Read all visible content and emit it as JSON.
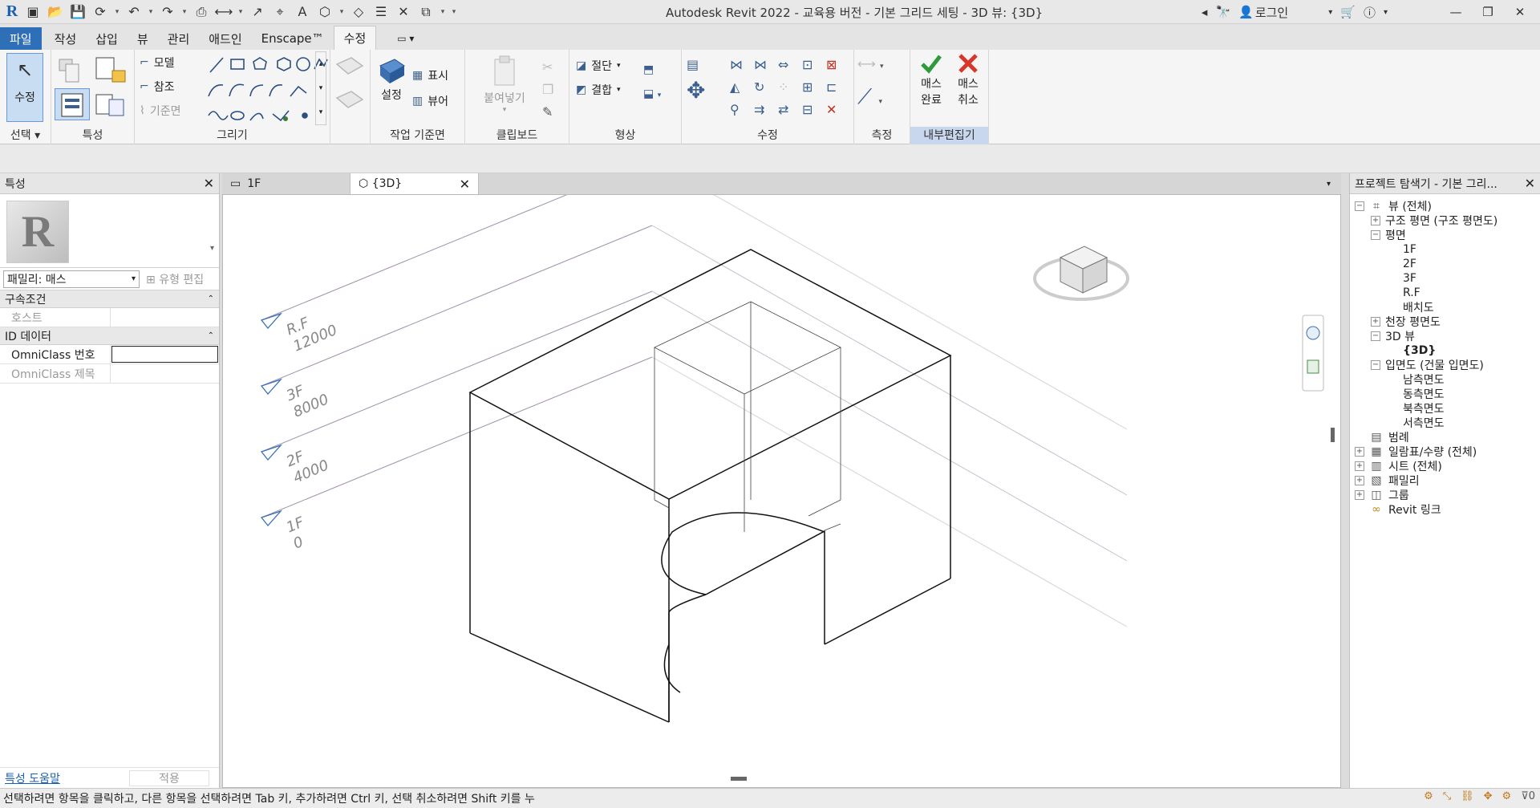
{
  "title_bar": {
    "window_title": "Autodesk Revit 2022 - 교육용 버전 - 기본 그리드 세팅 - 3D 뷰: {3D}",
    "login_label": "로그인"
  },
  "ribbon_tabs": [
    "파일",
    "작성",
    "삽입",
    "뷰",
    "관리",
    "애드인",
    "Enscape™",
    "수정"
  ],
  "ribbon": {
    "select": {
      "modify_label": "수정",
      "panel_label": "선택"
    },
    "properties": {
      "panel_label": "특성"
    },
    "draw": {
      "model_label": "모델",
      "ref_label": "참조",
      "plane_label": "기준면",
      "panel_label": "그리기"
    },
    "workplane": {
      "set_label": "설정",
      "show_label": "표시",
      "viewer_label": "뷰어",
      "panel_label": "작업 기준면"
    },
    "clipboard": {
      "paste_label": "붙여넣기",
      "panel_label": "클립보드"
    },
    "geometry": {
      "cut_label": "절단",
      "join_label": "결합",
      "panel_label": "형상"
    },
    "modify": {
      "panel_label": "수정"
    },
    "measure": {
      "panel_label": "측정"
    },
    "inplace": {
      "finish_label": "매스\n완료",
      "finish_l1": "매스",
      "finish_l2": "완료",
      "cancel_l1": "매스",
      "cancel_l2": "취소",
      "panel_label": "내부편집기"
    }
  },
  "properties_palette": {
    "title": "특성",
    "family_label": "패밀리: 매스",
    "edit_type_label": "유형 편집",
    "groups": [
      {
        "name": "구속조건",
        "rows": [
          {
            "key": "호스트",
            "value": ""
          }
        ]
      },
      {
        "name": "ID 데이터",
        "rows": [
          {
            "key": "OmniClass 번호",
            "value": ""
          },
          {
            "key": "OmniClass 제목",
            "value": ""
          }
        ]
      }
    ],
    "help_link": "특성 도움말",
    "apply_label": "적용"
  },
  "view_tabs": [
    {
      "label": "1F",
      "active": false
    },
    {
      "label": "{3D}",
      "active": true
    }
  ],
  "levels": [
    {
      "name": "R.F",
      "elevation": "12000"
    },
    {
      "name": "3F",
      "elevation": "8000"
    },
    {
      "name": "2F",
      "elevation": "4000"
    },
    {
      "name": "1F",
      "elevation": "0"
    }
  ],
  "project_browser": {
    "title": "프로젝트 탐색기 - 기본 그리...",
    "nodes": [
      {
        "label": "뷰 (전체)",
        "depth": 0,
        "toggle": "−",
        "icon": "views-icon"
      },
      {
        "label": "구조 평면 (구조 평면도)",
        "depth": 1,
        "toggle": "+"
      },
      {
        "label": "평면",
        "depth": 1,
        "toggle": "−"
      },
      {
        "label": "1F",
        "depth": 2
      },
      {
        "label": "2F",
        "depth": 2
      },
      {
        "label": "3F",
        "depth": 2
      },
      {
        "label": "R.F",
        "depth": 2
      },
      {
        "label": "배치도",
        "depth": 2
      },
      {
        "label": "천장 평면도",
        "depth": 1,
        "toggle": "+"
      },
      {
        "label": "3D 뷰",
        "depth": 1,
        "toggle": "−"
      },
      {
        "label": "{3D}",
        "depth": 2,
        "bold": true
      },
      {
        "label": "입면도 (건물 입면도)",
        "depth": 1,
        "toggle": "−"
      },
      {
        "label": "남측면도",
        "depth": 2
      },
      {
        "label": "동측면도",
        "depth": 2
      },
      {
        "label": "북측면도",
        "depth": 2
      },
      {
        "label": "서측면도",
        "depth": 2
      },
      {
        "label": "범례",
        "depth": 0,
        "icon": "legend-icon"
      },
      {
        "label": "일람표/수량 (전체)",
        "depth": 0,
        "toggle": "+",
        "icon": "schedule-icon"
      },
      {
        "label": "시트 (전체)",
        "depth": 0,
        "toggle": "+",
        "icon": "sheet-icon"
      },
      {
        "label": "패밀리",
        "depth": 0,
        "toggle": "+",
        "icon": "family-icon"
      },
      {
        "label": "그룹",
        "depth": 0,
        "toggle": "+",
        "icon": "group-icon"
      },
      {
        "label": "Revit 링크",
        "depth": 0,
        "icon": "link-icon"
      }
    ]
  },
  "status_bar": {
    "message": "선택하려면 항목을 클릭하고, 다른 항목을 선택하려면 Tab 키, 추가하려면 Ctrl 키, 선택 취소하려면 Shift 키를 누",
    "filter_count": "0"
  },
  "colors": {
    "file_tab": "#2f6fb8",
    "accent_blue": "#3b5f8f",
    "confirm_green": "#2e9a3a",
    "cancel_red": "#d9362b",
    "level_line": "#9a8aa0",
    "level_marker": "#3a6fb8"
  }
}
